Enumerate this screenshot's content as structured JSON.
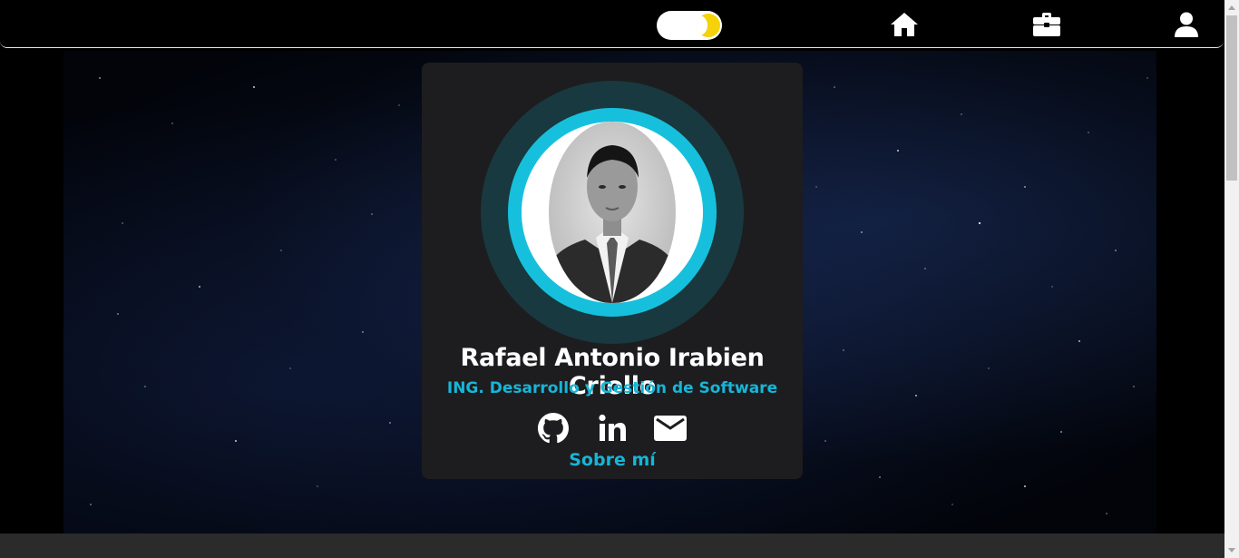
{
  "navbar": {
    "theme_toggle": {
      "state": "dark",
      "icon": "moon-icon",
      "knob_color": "#f5d20a"
    },
    "items": [
      {
        "icon": "home-icon"
      },
      {
        "icon": "briefcase-icon"
      },
      {
        "icon": "user-icon"
      }
    ]
  },
  "profile": {
    "name": "Rafael Antonio Irabien Criollo",
    "role": "ING. Desarrollo y Gestión de Software",
    "photo": "profile-photo",
    "social": [
      {
        "icon": "github-icon"
      },
      {
        "icon": "linkedin-icon"
      },
      {
        "icon": "email-icon"
      }
    ],
    "about_label": "Sobre mí"
  },
  "colors": {
    "accent": "#16c0dd",
    "card": "#1d1d1f",
    "background": "#000000"
  }
}
